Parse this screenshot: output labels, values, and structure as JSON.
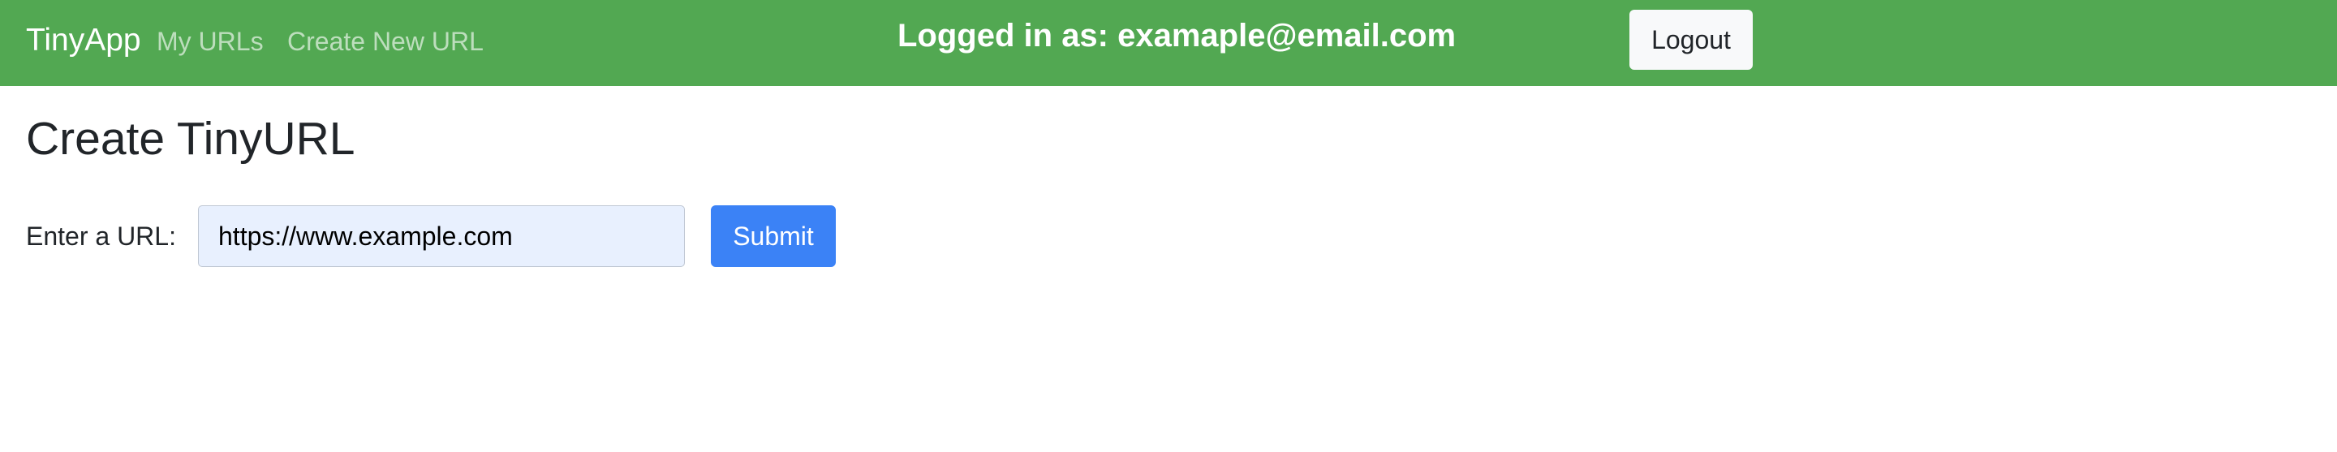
{
  "navbar": {
    "brand": "TinyApp",
    "links": [
      {
        "label": "My URLs"
      },
      {
        "label": "Create New URL"
      }
    ],
    "logged_in_text": "Logged in as: examaple@email.com",
    "logout_label": "Logout",
    "background_color": "#52a852"
  },
  "main": {
    "title": "Create TinyURL",
    "form": {
      "label": "Enter a URL:",
      "input_value": "https://www.example.com",
      "submit_label": "Submit"
    }
  },
  "colors": {
    "accent": "#3b82f6",
    "navbar": "#52a852",
    "input_background": "#e8f0fe"
  }
}
